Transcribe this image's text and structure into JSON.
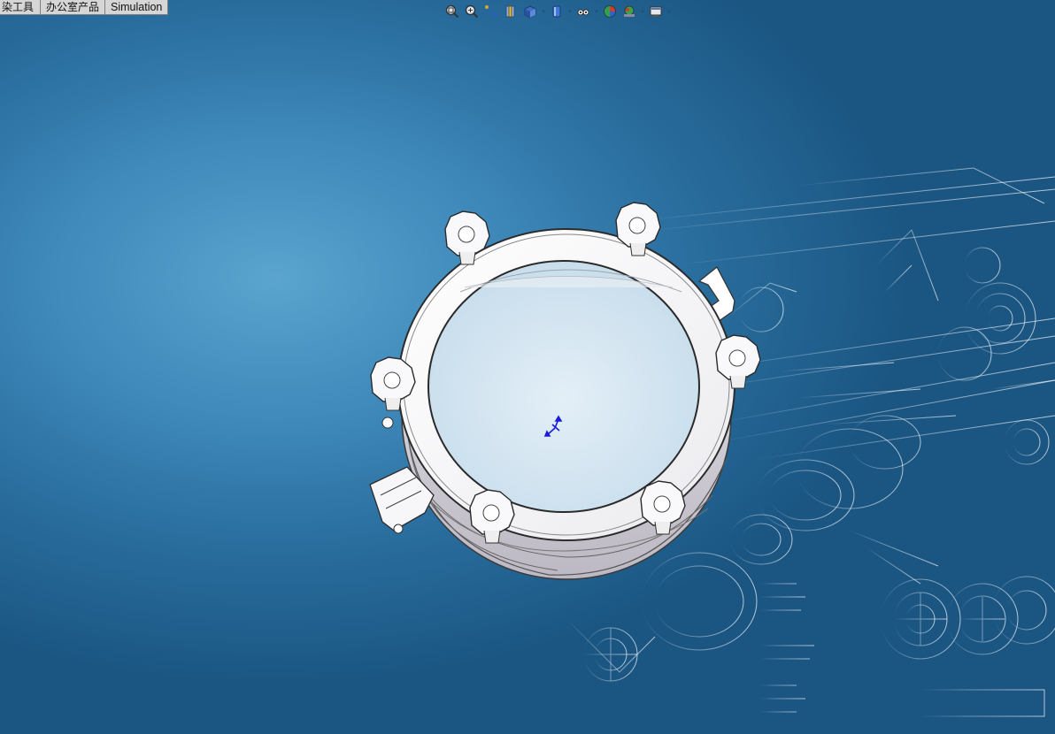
{
  "command_manager": {
    "tabs": [
      {
        "label": "染工具"
      },
      {
        "label": "办公室产品"
      },
      {
        "label": "Simulation"
      }
    ]
  },
  "heads_up_toolbar": {
    "buttons": [
      {
        "icon": "zoom-to-fit-icon"
      },
      {
        "icon": "zoom-to-area-icon"
      },
      {
        "icon": "previous-view-icon"
      },
      {
        "icon": "section-view-icon"
      },
      {
        "icon": "view-orientation-icon"
      },
      {
        "icon": "display-style-icon"
      },
      {
        "icon": "hide-show-items-icon"
      },
      {
        "icon": "edit-appearance-icon"
      },
      {
        "icon": "apply-scene-icon"
      },
      {
        "icon": "view-settings-icon"
      }
    ]
  },
  "graphics_area": {
    "background_colors": {
      "center": "#5aa4cf",
      "edge": "#1b5683"
    },
    "model": "sight-glass-manway-assembly",
    "model_colors": {
      "body": "#f4f4f6",
      "edge": "#3a3a3a",
      "glass": "#cfe4f1"
    },
    "triad_colors": {
      "axes": "#1a1ad8"
    }
  }
}
